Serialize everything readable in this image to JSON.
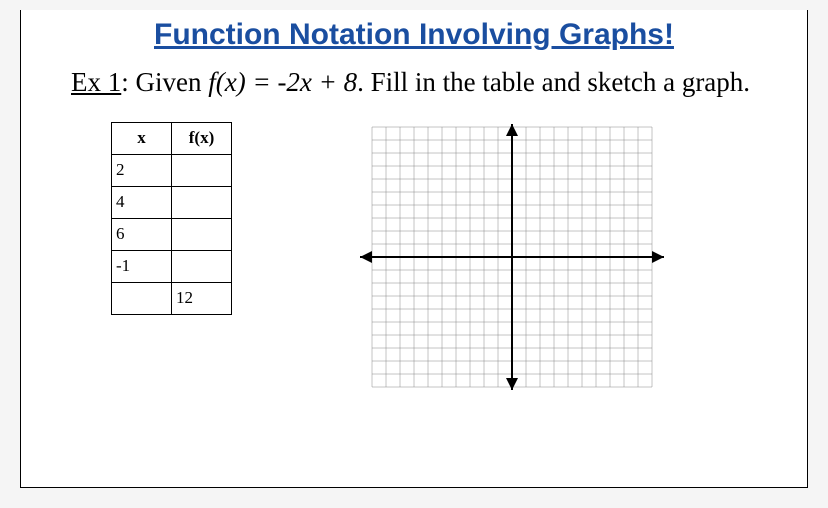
{
  "title": "Function Notation Involving Graphs!",
  "example_label": "Ex 1",
  "prompt_prefix": ":  Given ",
  "function_def": "f(x) = -2x + 8",
  "prompt_suffix": ". Fill in the table and sketch a graph.",
  "table": {
    "headers": [
      "x",
      "f(x)"
    ],
    "rows": [
      {
        "x": "2",
        "fx": ""
      },
      {
        "x": "4",
        "fx": ""
      },
      {
        "x": "6",
        "fx": ""
      },
      {
        "x": "-1",
        "fx": ""
      },
      {
        "x": "",
        "fx": "12"
      }
    ]
  },
  "chart_data": {
    "type": "scatter",
    "title": "",
    "xlabel": "",
    "ylabel": "",
    "xlim": [
      -10,
      10
    ],
    "ylim": [
      -10,
      10
    ],
    "grid": true,
    "series": []
  }
}
